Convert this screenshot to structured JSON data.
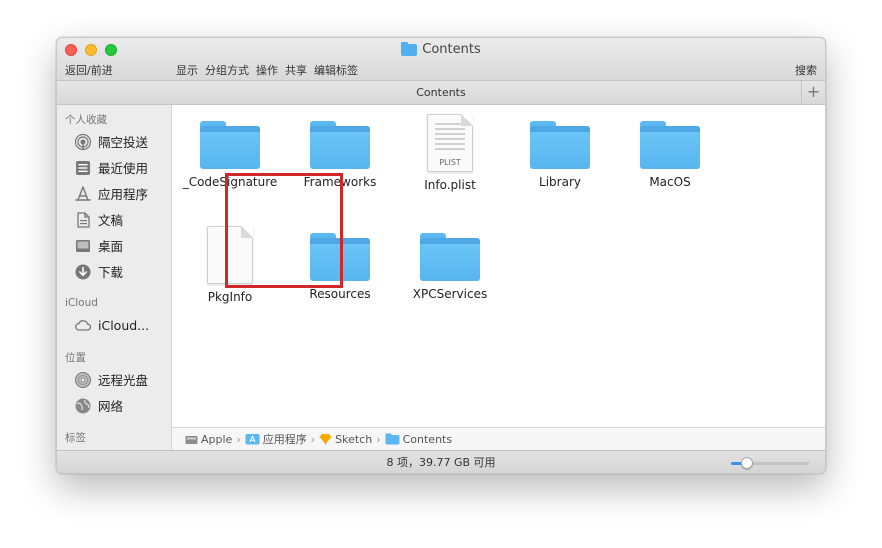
{
  "window": {
    "title": "Contents",
    "toolbar": {
      "back_forward": "返回/前进",
      "view": "显示",
      "group": "分组方式",
      "action": "操作",
      "share": "共享",
      "tags": "编辑标签",
      "search": "搜索"
    },
    "tab_title": "Contents",
    "add_tab": "+"
  },
  "sidebar": {
    "favorites_heading": "个人收藏",
    "favorites": [
      {
        "label": "隔空投送",
        "icon": "airdrop-icon"
      },
      {
        "label": "最近使用",
        "icon": "recents-icon"
      },
      {
        "label": "应用程序",
        "icon": "applications-icon"
      },
      {
        "label": "文稿",
        "icon": "documents-icon"
      },
      {
        "label": "桌面",
        "icon": "desktop-icon"
      },
      {
        "label": "下载",
        "icon": "downloads-icon"
      }
    ],
    "icloud_heading": "iCloud",
    "icloud": [
      {
        "label": "iCloud...",
        "icon": "cloud-icon"
      }
    ],
    "locations_heading": "位置",
    "locations": [
      {
        "label": "远程光盘",
        "icon": "disc-icon"
      },
      {
        "label": "网络",
        "icon": "network-icon"
      }
    ],
    "tags_heading": "标签"
  },
  "files": [
    {
      "name": "_CodeSignature",
      "kind": "folder"
    },
    {
      "name": "Frameworks",
      "kind": "folder"
    },
    {
      "name": "Info.plist",
      "kind": "document",
      "tag": "PLIST"
    },
    {
      "name": "Library",
      "kind": "folder"
    },
    {
      "name": "MacOS",
      "kind": "folder"
    },
    {
      "name": "PkgInfo",
      "kind": "document"
    },
    {
      "name": "Resources",
      "kind": "folder",
      "highlighted": true
    },
    {
      "name": "XPCServices",
      "kind": "folder"
    }
  ],
  "path": [
    {
      "label": "Apple",
      "icon": "disk-icon"
    },
    {
      "label": "应用程序",
      "icon": "applications-folder-icon"
    },
    {
      "label": "Sketch",
      "icon": "sketch-icon"
    },
    {
      "label": "Contents",
      "icon": "folder-icon"
    }
  ],
  "status": {
    "text": "8 项，39.77 GB 可用",
    "icon_size_level": 0.2
  },
  "colors": {
    "folder": "#5bb8f2",
    "highlight": "#d0272b",
    "slider_accent": "#3d8ef5"
  }
}
